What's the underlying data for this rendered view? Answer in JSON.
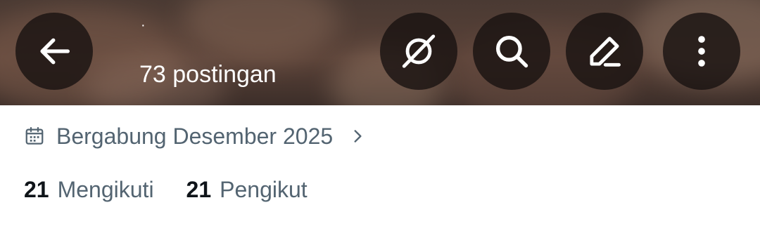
{
  "header": {
    "username": "·",
    "post_count": "73 postingan",
    "buttons": {
      "back": "arrow-left-icon",
      "grok": "grok-icon",
      "search": "search-icon",
      "edit": "pencil-icon",
      "more": "more-vertical-icon"
    }
  },
  "profile": {
    "joined": "Bergabung Desember 2025",
    "following_count": "21",
    "following_label": "Mengikuti",
    "followers_count": "21",
    "followers_label": "Pengikut"
  },
  "colors": {
    "text_primary": "#0f1419",
    "text_secondary": "#536471",
    "button_bg": "#181210"
  }
}
